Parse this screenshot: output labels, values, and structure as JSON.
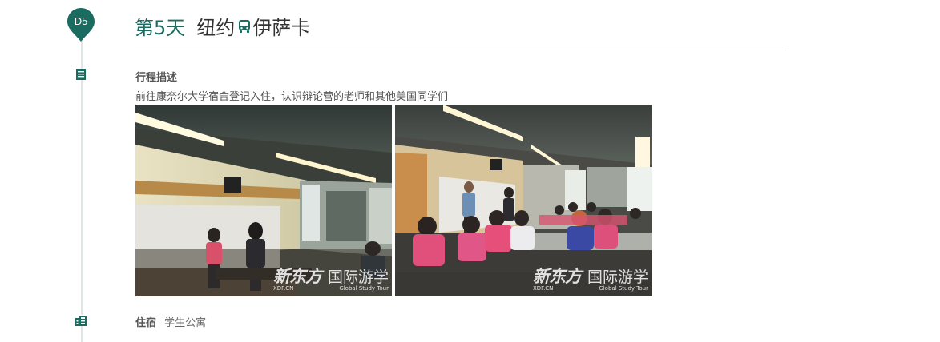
{
  "day_badge": "D5",
  "title": {
    "day": "第5天",
    "from_city": "纽约",
    "to_city": "伊萨卡",
    "transport_icon": "bus-icon"
  },
  "itinerary": {
    "heading": "行程描述",
    "description": "前往康奈尔大学宿舍登记入住，认识辩论营的老师和其他美国同学们",
    "icon": "document-icon"
  },
  "photos": [
    {
      "name": "classroom-photo-1",
      "watermark_main": "新东方",
      "watermark_sub": "国际游学",
      "watermark_domain": "XDF.CN",
      "watermark_tagline": "Global Study Tour"
    },
    {
      "name": "classroom-photo-2",
      "watermark_main": "新东方",
      "watermark_sub": "国际游学",
      "watermark_domain": "XDF.CN",
      "watermark_tagline": "Global Study Tour"
    }
  ],
  "stay": {
    "label": "住宿",
    "value": "学生公寓",
    "icon": "building-icon"
  },
  "colors": {
    "accent": "#1a6b60",
    "timeline": "#dfe7e6",
    "rule": "#dcdcdc"
  }
}
